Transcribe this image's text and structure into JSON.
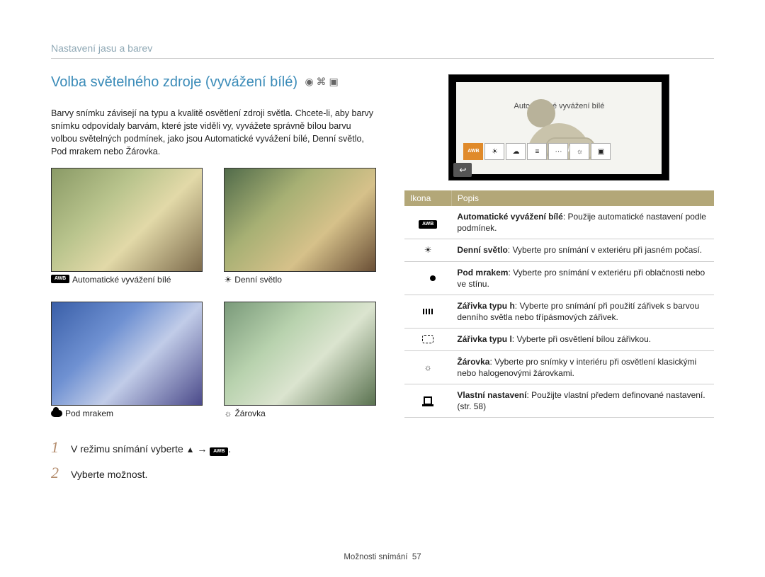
{
  "breadcrumb": "Nastavení jasu a barev",
  "title": "Volba světelného zdroje (vyvážení bílé)",
  "intro": "Barvy snímku závisejí na typu a kvalitě osvětlení zdroji světla. Chcete-li, aby barvy snímku odpovídaly barvám, které jste viděli vy, vyvážete správně bílou barvu volbou světelných podmínek, jako jsou Automatické vyvážení bílé, Denní světlo, Pod mrakem nebo Žárovka.",
  "tiles": {
    "awb_badge": "AWB",
    "awb": "Automatické vyvážení bílé",
    "daylight": "Denní světlo",
    "cloudy": "Pod mrakem",
    "tungsten": "Žárovka"
  },
  "steps": {
    "s1_pre": "V režimu snímání vyberte",
    "s1_arrow": "→",
    "s1_badge": "AWB",
    "s1_post": ".",
    "s2": "Vyberte možnost."
  },
  "display": {
    "label": "Automatické vyvážení bílé",
    "badge": "AWB",
    "row_badge": "AWB"
  },
  "table": {
    "h_icon": "Ikona",
    "h_desc": "Popis",
    "rows": [
      {
        "icon_badge": "AWB",
        "b": "Automatické vyvážení bílé",
        "t": ": Použije automatické nastavení podle podmínek."
      },
      {
        "icon": "sun",
        "b": "Denní světlo",
        "t": ": Vyberte pro snímání v exteriéru při jasném počasí."
      },
      {
        "icon": "cloud",
        "b": "Pod mrakem",
        "t": ": Vyberte pro snímání v exteriéru při oblačnosti nebo ve stínu."
      },
      {
        "icon": "tube",
        "b": "Zářivka typu h",
        "t": ": Vyberte pro snímání při použití zářivek s barvou denního světla nebo třípásmových zářivek."
      },
      {
        "icon": "tube2",
        "b": "Zářivka typu l",
        "t": ": Vyberte při osvětlení bílou zářivkou."
      },
      {
        "icon": "bulb",
        "b": "Žárovka",
        "t": ": Vyberte pro snímky v interiéru při osvětlení klasickými nebo halogenovými žárovkami."
      },
      {
        "icon": "custom",
        "b": "Vlastní nastavení",
        "t": ": Použijte vlastní předem definované nastavení. (str. 58)"
      }
    ]
  },
  "footer": {
    "section": "Možnosti snímání",
    "page": "57"
  }
}
